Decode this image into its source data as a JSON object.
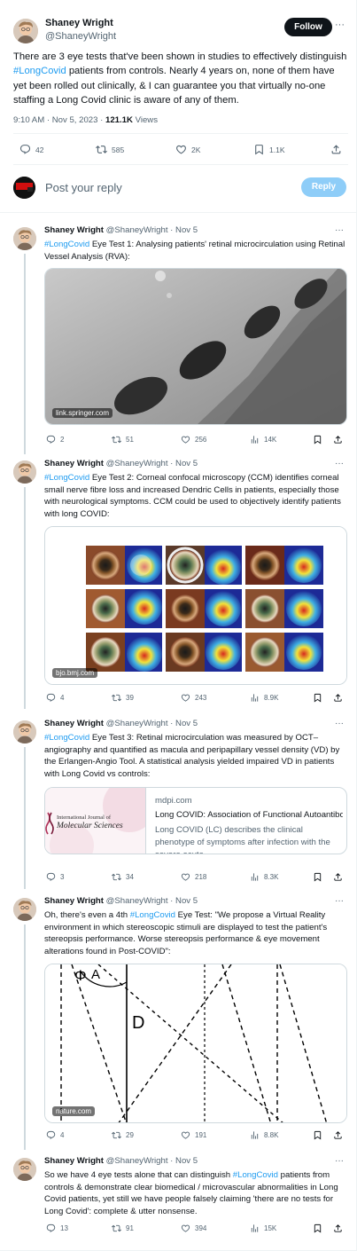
{
  "main": {
    "author_name": "Shaney Wright",
    "author_handle": "@ShaneyWright",
    "follow_label": "Follow",
    "more": "···",
    "text_before": "There are 3 eye tests that've been shown in studies to effectively distinguish ",
    "hashtag": "#LongCovid",
    "text_after": " patients from controls. Nearly 4 years on, none of them have yet been rolled out clinically, & I can guarantee you that virtually no-one staffing a Long Covid clinic is aware of any of them.",
    "timestamp": "9:10 AM · Nov 5, 2023 · ",
    "views_count": "121.1K",
    "views_label": " Views",
    "stats": {
      "replies": "42",
      "reposts": "585",
      "likes": "2K",
      "bookmarks": "1.1K"
    }
  },
  "composer": {
    "placeholder": "Post your reply",
    "reply_label": "Reply"
  },
  "replies": [
    {
      "name": "Shaney Wright",
      "handle": "@ShaneyWright",
      "date": " · Nov 5",
      "hashtag": "#LongCovid",
      "text": " Eye Test 1: Analysing patients' retinal microcirculation using Retinal Vessel Analysis (RVA):",
      "media_source": "link.springer.com",
      "stats": {
        "replies": "2",
        "reposts": "51",
        "likes": "256",
        "views": "14K"
      }
    },
    {
      "name": "Shaney Wright",
      "handle": "@ShaneyWright",
      "date": " · Nov 5",
      "hashtag": "#LongCovid",
      "text": " Eye Test 2: Corneal confocal microscopy (CCM) identifies corneal small nerve fibre loss and increased Dendric Cells in patients, especially those with neurological symptoms. CCM could be used to objectively identify patients with long COVID:",
      "media_source": "bjo.bmj.com",
      "stats": {
        "replies": "4",
        "reposts": "39",
        "likes": "243",
        "views": "8.9K"
      }
    },
    {
      "name": "Shaney Wright",
      "handle": "@ShaneyWright",
      "date": " · Nov 5",
      "hashtag": "#LongCovid",
      "text": " Eye Test 3: Retinal microcirculation was measured by OCT–angiography and quantified as macula and peripapillary vessel density (VD) by the Erlangen-Angio Tool. A statistical analysis yielded impaired VD in patients with Long Covid vs controls:",
      "card": {
        "domain": "mdpi.com",
        "title": "Long COVID: Association of Functional Autoantibodies with ...",
        "description": "Long COVID (LC) describes the clinical phenotype of symptoms after infection with the severe acute ...",
        "journal_line1": "International Journal of",
        "journal_line2": "Molecular Sciences"
      },
      "stats": {
        "replies": "3",
        "reposts": "34",
        "likes": "218",
        "views": "8.3K"
      }
    },
    {
      "name": "Shaney Wright",
      "handle": "@ShaneyWright",
      "date": " · Nov 5",
      "text_pre": "Oh, there's even a 4th ",
      "hashtag": "#LongCovid",
      "text": " Eye Test: \"We propose a Virtual Reality environment in which stereoscopic stimuli are displayed to test the patient's stereopsis performance. Worse stereopsis performance & eye movement alterations found in Post-COVID\":",
      "media_source": "nature.com",
      "diagram_labels": {
        "phi": "Φ",
        "a": "A",
        "d": "D"
      },
      "stats": {
        "replies": "4",
        "reposts": "29",
        "likes": "191",
        "views": "8.8K"
      }
    },
    {
      "name": "Shaney Wright",
      "handle": "@ShaneyWright",
      "date": " · Nov 5",
      "text_pre": "So we have 4 eye tests alone that can distinguish ",
      "hashtag": "#LongCovid",
      "text": " patients from controls & demonstrate clear biomedical / microvascular abnormalities in Long Covid patients, yet still we have people falsely claiming 'there are no tests for Long Covid': complete & utter nonsense.",
      "stats": {
        "replies": "13",
        "reposts": "91",
        "likes": "394",
        "views": "15K"
      }
    }
  ]
}
